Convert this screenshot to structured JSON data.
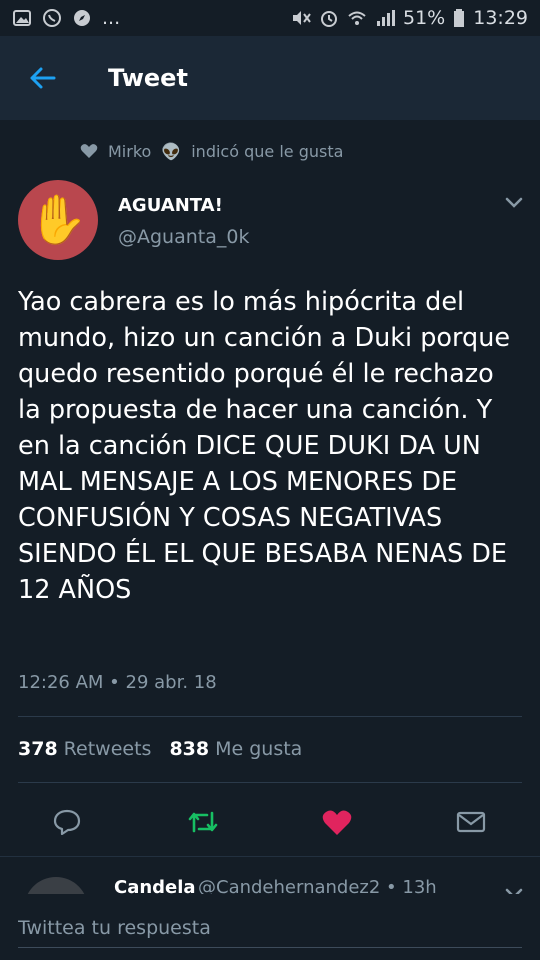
{
  "status_bar": {
    "left_icons": [
      "image-icon",
      "whatsapp-icon",
      "compass-icon"
    ],
    "ellipsis": "...",
    "right_icons": [
      "mute-icon",
      "alarm-icon",
      "wifi-icon",
      "signal-icon"
    ],
    "battery": "51%",
    "time": "13:29"
  },
  "app_bar": {
    "title": "Tweet"
  },
  "liked_by": {
    "user": "Mirko",
    "emoji": "👽",
    "text": "indicó que le gusta"
  },
  "tweet": {
    "author_name": "AGUANTA!",
    "author_handle": "@Aguanta_0k",
    "avatar_emoji": "✋",
    "text": "Yao cabrera es lo más hipócrita del mundo, hizo un canción a Duki porque quedo resentido porqué él le rechazo la propuesta de hacer una canción. Y en la canción DICE QUE DUKI DA UN MAL MENSAJE A LOS MENORES DE CONFUSIÓN Y COSAS NEGATIVAS SIENDO ÉL EL QUE BESABA NENAS DE 12 AÑOS",
    "timestamp": "12:26 AM • 29 abr. 18"
  },
  "stats": {
    "retweets_count": "378",
    "retweets_label": "Retweets",
    "likes_count": "838",
    "likes_label": "Me gusta"
  },
  "colors": {
    "background": "#141d26",
    "app_bar": "#1b2836",
    "accent_blue": "#1da1f2",
    "retweet_green": "#17bf63",
    "like_red": "#e0245e",
    "muted": "#8899a6"
  },
  "reply": {
    "name": "Candela",
    "meta": "@Candehernandez2 • 13h"
  },
  "compose": {
    "placeholder": "Twittea tu respuesta"
  }
}
